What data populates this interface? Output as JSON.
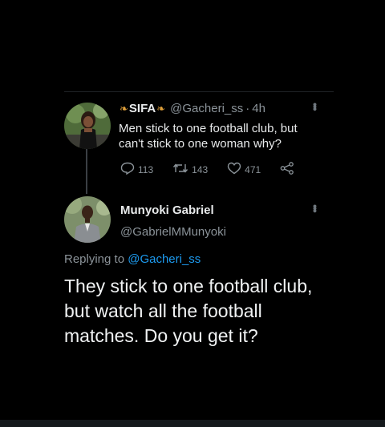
{
  "original_tweet": {
    "display_name": "SIFA",
    "emoji_left": "butterfly",
    "emoji_right": "butterfly",
    "handle": "@Gacheri_ss",
    "separator": "·",
    "time": "4h",
    "text": "Men stick to one football club, but can't stick to one woman why?",
    "replies": "113",
    "retweets": "143",
    "likes": "471"
  },
  "reply_tweet": {
    "display_name": "Munyoki Gabriel",
    "handle": "@GabrielMMunyoki",
    "replying_prefix": "Replying to",
    "replying_to": "@Gacheri_ss",
    "text": "They stick to one football club, but watch all the football matches. Do you get it?"
  },
  "colors": {
    "background": "#000000",
    "mention": "#1d9bf0",
    "muted": "#8b9399",
    "emoji": "#e3a23b"
  }
}
